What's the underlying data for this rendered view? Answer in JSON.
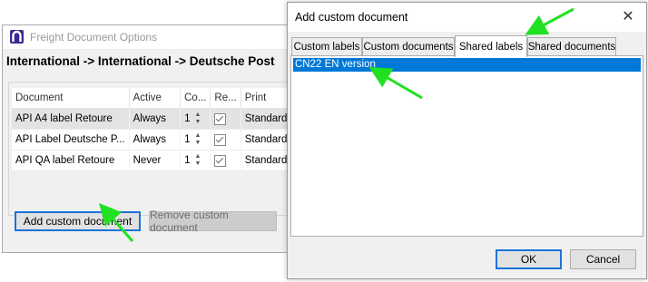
{
  "back_window": {
    "title": "Freight Document Options",
    "route": "International -> International -> Deutsche Post",
    "columns": [
      "Document",
      "Active",
      "Co...",
      "Re...",
      "Print"
    ],
    "rows": [
      {
        "document": "API A4 label Retoure",
        "active": "Always",
        "count": "1",
        "print": "Standard"
      },
      {
        "document": "API Label Deutsche P...",
        "active": "Always",
        "count": "1",
        "print": "Standard"
      },
      {
        "document": "API QA label Retoure",
        "active": "Never",
        "count": "1",
        "print": "Standard"
      }
    ],
    "add_button": "Add custom document",
    "remove_button": "Remove custom document"
  },
  "dialog": {
    "title": "Add custom document",
    "tabs": [
      "Custom labels",
      "Custom documents",
      "Shared labels",
      "Shared documents"
    ],
    "active_tab": "Shared labels",
    "list_items": [
      "CN22 EN version"
    ],
    "ok_button": "OK",
    "cancel_button": "Cancel"
  },
  "colors": {
    "accent": "#0078d7",
    "annotation_arrow": "#22e022",
    "app_icon": "#3b2a8f"
  }
}
